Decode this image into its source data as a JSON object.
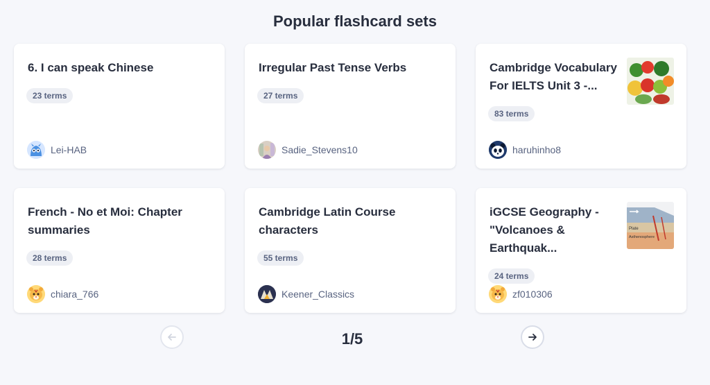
{
  "heading": "Popular flashcard sets",
  "cards": [
    {
      "title": "6. I can speak Chinese",
      "terms": "23 terms",
      "author": "Lei-HAB",
      "avatar_icon": "blue-creature-avatar-icon"
    },
    {
      "title": "Irregular Past Tense Verbs",
      "terms": "27 terms",
      "author": "Sadie_Stevens10",
      "avatar_icon": "photo-avatar-icon"
    },
    {
      "title": "Cambridge Vocabulary For IELTS Unit 3 -...",
      "terms": "83 terms",
      "author": "haruhinho8",
      "avatar_icon": "panda-avatar-icon",
      "thumbnail": "fruit-vegetables-thumbnail"
    },
    {
      "title": "French - No et Moi: Chapter summaries",
      "terms": "28 terms",
      "author": "chiara_766",
      "avatar_icon": "tiger-avatar-icon"
    },
    {
      "title": "Cambridge Latin Course characters",
      "terms": "55 terms",
      "author": "Keener_Classics",
      "avatar_icon": "photo-avatar-icon"
    },
    {
      "title": "iGCSE Geography - \"Volcanoes & Earthquak...",
      "terms": "24 terms",
      "author": "zf010306",
      "avatar_icon": "tiger-avatar-icon",
      "thumbnail": "plate-tectonics-diagram-thumbnail",
      "thumbnail_labels": [
        "Plate",
        "Asthenosphere"
      ]
    }
  ],
  "pagination": {
    "page": "1/5",
    "prev_icon": "arrow-left-icon",
    "next_icon": "arrow-right-icon",
    "prev_disabled": true
  },
  "colors": {
    "background": "#f6f7fb",
    "card": "#ffffff",
    "text": "#282e3e",
    "muted": "#586380",
    "badge": "#edeff4"
  }
}
